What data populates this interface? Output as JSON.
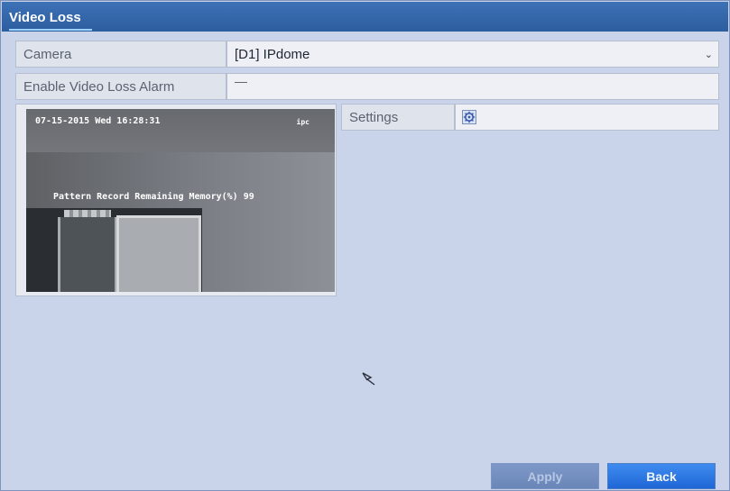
{
  "window": {
    "tab_label": "Video Loss"
  },
  "camera": {
    "label": "Camera",
    "value": "[D1] IPdome"
  },
  "video_loss": {
    "label": "Enable Video Loss Alarm",
    "checked": false
  },
  "preview": {
    "timestamp": "07-15-2015 Wed 16:28:31",
    "tag": "ipc",
    "message": "Pattern Record Remaining Memory(%)  99"
  },
  "settings": {
    "label": "Settings",
    "icon": "gear-icon"
  },
  "buttons": {
    "apply": "Apply",
    "back": "Back"
  }
}
